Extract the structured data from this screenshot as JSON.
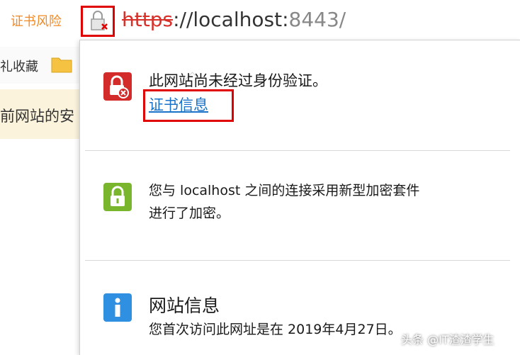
{
  "address_bar": {
    "cert_risk": "证书风险",
    "url_scheme": "https",
    "url_host": "://localhost:",
    "url_port": "8443",
    "url_tail": "/"
  },
  "background": {
    "bookmark_label": "礼收藏",
    "notice_text": "前网站的安"
  },
  "panel": {
    "identity": {
      "title": "此网站尚未经过身份验证。",
      "link": "证书信息"
    },
    "encryption": {
      "line1": "您与 localhost 之间的连接采用新型加密套件",
      "line2": "进行了加密。"
    },
    "site_info": {
      "title": "网站信息",
      "line": "您首次访问此网址是在 2019年4月27日。"
    }
  },
  "watermark": "头条 @IT渣渣学生",
  "colors": {
    "danger": "#d32a2a",
    "secure": "#7ab52e",
    "info": "#2f8fe0",
    "annotation": "#e00000",
    "link": "#1a73c8"
  }
}
